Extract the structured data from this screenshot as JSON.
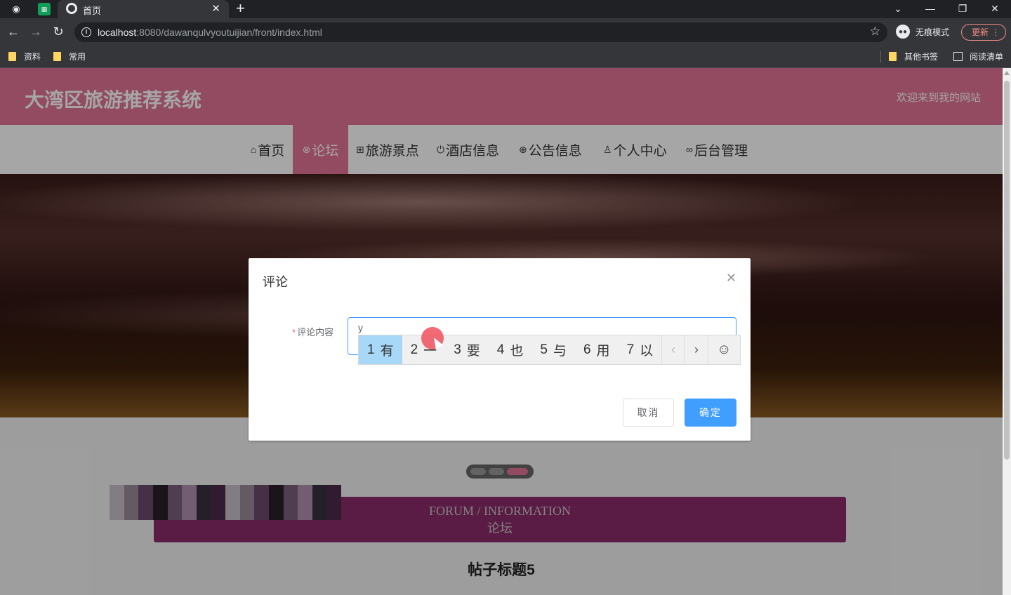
{
  "browser": {
    "tab_title": "首页",
    "url_host": "localhost",
    "url_rest": ":8080/dawanqulvyoutuijian/front/index.html",
    "incognito_label": "无痕模式",
    "update_label": "更新",
    "bookmarks": [
      "资料",
      "常用"
    ],
    "bookmarks_right": [
      "其他书签",
      "阅读清单"
    ]
  },
  "site": {
    "title": "大湾区旅游推荐系统",
    "welcome": "欢迎来到我的网站",
    "nav": [
      {
        "icon": "⌂",
        "label": "首页"
      },
      {
        "icon": "⊗",
        "label": "论坛"
      },
      {
        "icon": "⊞",
        "label": "旅游景点"
      },
      {
        "icon": "⏻",
        "label": "酒店信息"
      },
      {
        "icon": "⊕",
        "label": "公告信息"
      },
      {
        "icon": "♙",
        "label": "个人中心"
      },
      {
        "icon": "∞",
        "label": "后台管理"
      }
    ],
    "active_nav": "论坛",
    "forum_en": "FORUM / INFORMATION",
    "forum_cn": "论坛",
    "post_title": "帖子标题5"
  },
  "dialog": {
    "title": "评论",
    "field_required_mark": "*",
    "field_label": "评论内容",
    "input_value": "y",
    "cancel_label": "取消",
    "confirm_label": "确定"
  },
  "ime": {
    "candidates": [
      {
        "num": "1",
        "text": "有"
      },
      {
        "num": "2",
        "text": "一"
      },
      {
        "num": "3",
        "text": "要"
      },
      {
        "num": "4",
        "text": "也"
      },
      {
        "num": "5",
        "text": "与"
      },
      {
        "num": "6",
        "text": "用"
      },
      {
        "num": "7",
        "text": "以"
      }
    ],
    "selected_index": 0
  },
  "colors": {
    "brand_pink": "#e07495",
    "forum_purple": "#8b2a6b",
    "primary_blue": "#409eff"
  }
}
